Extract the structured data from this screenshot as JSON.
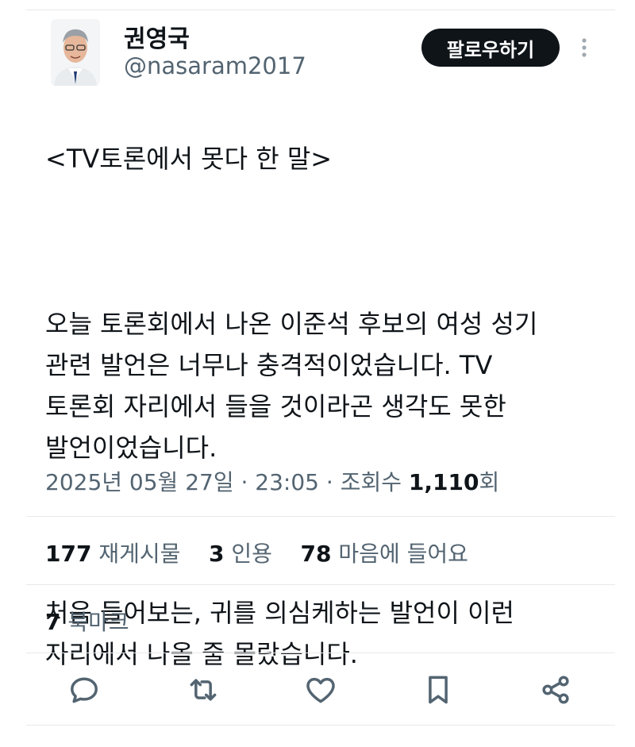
{
  "author": {
    "display_name": "권영국",
    "handle": "@nasaram2017"
  },
  "follow_label": "팔로우하기",
  "tweet": {
    "paragraphs": [
      "<TV토론에서 못다 한 말>",
      "오늘 토론회에서 나온 이준석 후보의 여성 성기\n관련 발언은 너무나 충격적이었습니다. TV\n토론회 자리에서 들을 것이라곤 생각도 못한\n발언이었습니다.",
      "처음 들어보는, 귀를 의심케하는 발언이 이런\n자리에서 나올 줄 몰랐습니다."
    ]
  },
  "meta": {
    "timestamp": "2025년 05월 27일 · 23:05",
    "separator": " · ",
    "views_label": "조회수",
    "views_count": "1,110",
    "views_suffix": "회"
  },
  "stats": {
    "retweets_count": "177",
    "retweets_label": "재게시물",
    "quotes_count": "3",
    "quotes_label": "인용",
    "likes_count": "78",
    "likes_label": "마음에 들어요",
    "bookmarks_count": "7",
    "bookmarks_label": "북마크"
  },
  "icons": {
    "more": "more-vertical-icon",
    "reply": "reply-icon",
    "retweet": "retweet-icon",
    "like": "heart-icon",
    "bookmark": "bookmark-icon",
    "share": "share-icon"
  },
  "colors": {
    "text": "#0f1419",
    "secondary": "#536471",
    "follow_bg": "#0f1419",
    "divider": "#e7e9ea"
  }
}
